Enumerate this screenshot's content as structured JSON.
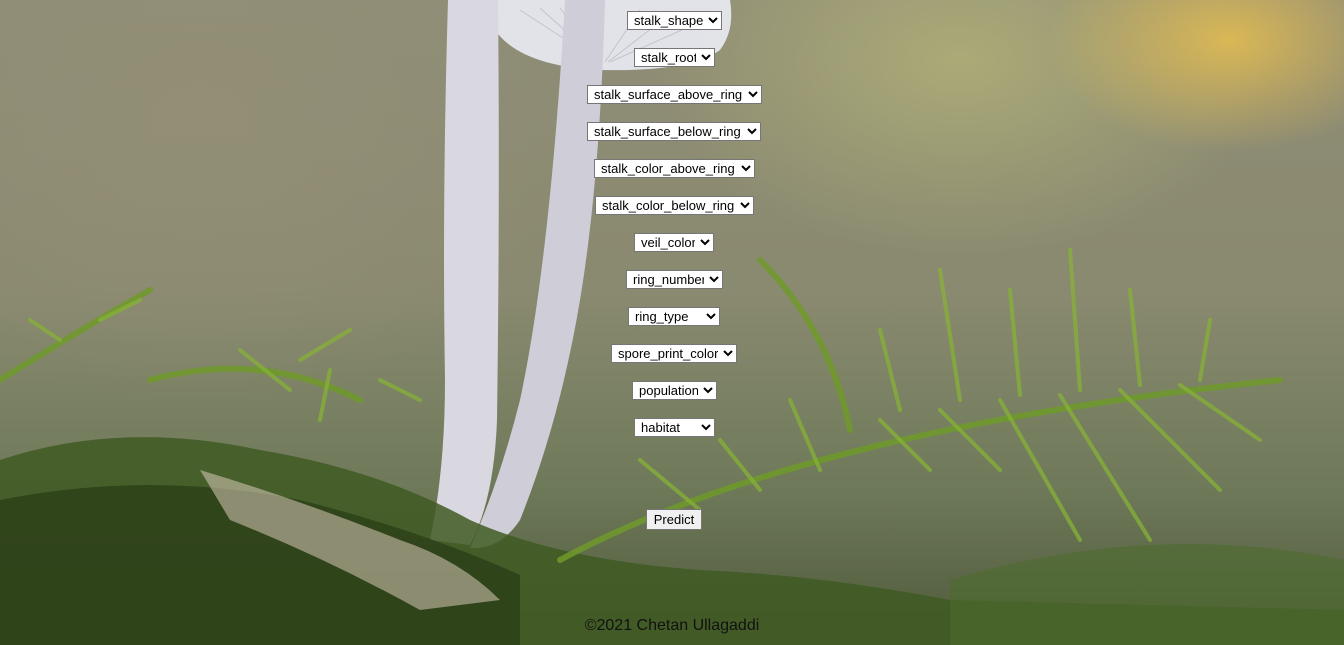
{
  "form": {
    "selects": [
      {
        "name": "stalk_shape",
        "value": "stalk_shape"
      },
      {
        "name": "stalk_root",
        "value": "stalk_root"
      },
      {
        "name": "stalk_surface_above_ring",
        "value": "stalk_surface_above_ring"
      },
      {
        "name": "stalk_surface_below_ring",
        "value": "stalk_surface_below_ring"
      },
      {
        "name": "stalk_color_above_ring",
        "value": "stalk_color_above_ring"
      },
      {
        "name": "stalk_color_below_ring",
        "value": "stalk_color_below_ring"
      },
      {
        "name": "veil_color",
        "value": "veil_color"
      },
      {
        "name": "ring_number",
        "value": "ring_number"
      },
      {
        "name": "ring_type",
        "value": "ring_type"
      },
      {
        "name": "spore_print_color",
        "value": "spore_print_color"
      },
      {
        "name": "population",
        "value": "population"
      },
      {
        "name": "habitat",
        "value": "habitat"
      }
    ],
    "predict_label": "Predict"
  },
  "footer": "©2021 Chetan Ullagaddi"
}
